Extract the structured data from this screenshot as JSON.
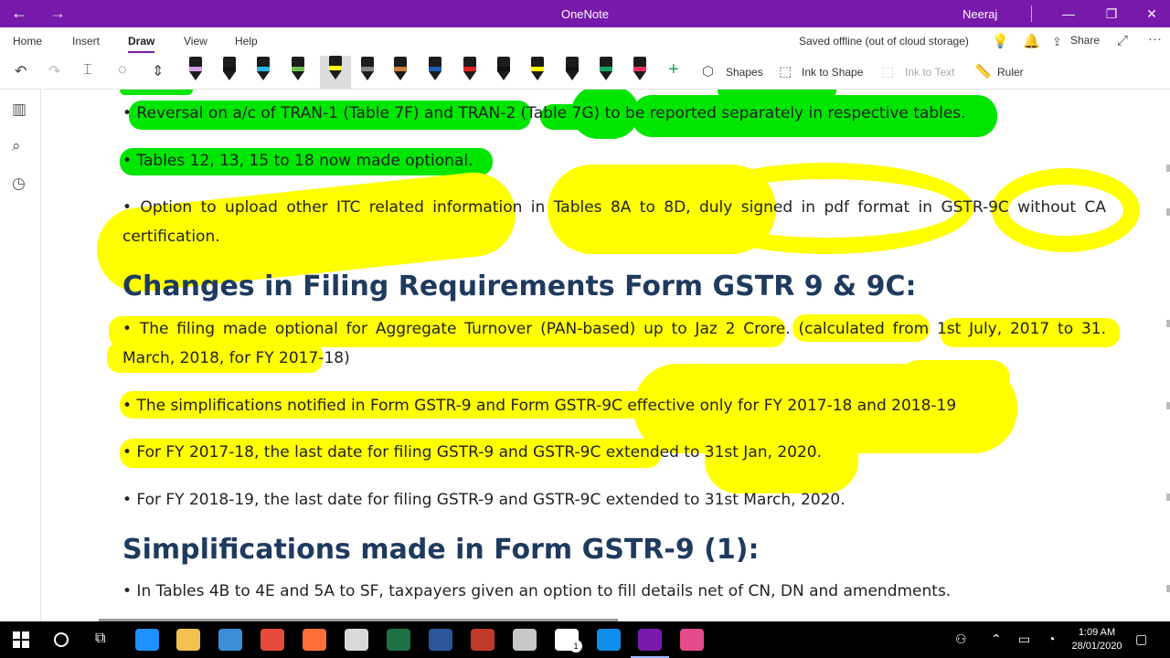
{
  "titlebar": {
    "back": "←",
    "forward": "→",
    "title": "OneNote",
    "user": "Neeraj",
    "minimize": "—",
    "restore": "❐",
    "close": "✕"
  },
  "menu": {
    "tabs": [
      "Home",
      "Insert",
      "Draw",
      "View",
      "Help"
    ],
    "active_tab": "Draw",
    "status": "Saved offline (out of cloud storage)",
    "share": "Share",
    "more": "···"
  },
  "toolbar": {
    "shapes": "Shapes",
    "ink_to_shape": "Ink to Shape",
    "ink_to_text": "Ink to Text",
    "ruler": "Ruler",
    "add": "+",
    "pens": [
      {
        "color": "#d7a0e8"
      },
      {
        "color": "#111111"
      },
      {
        "color": "#2ab7e8"
      },
      {
        "color": "#6cc24a"
      },
      {
        "color": "#ffff00",
        "selected": true
      },
      {
        "color": "#888888"
      },
      {
        "color": "#c77d3b"
      },
      {
        "color": "#1e5fb0"
      },
      {
        "color": "#e02020"
      },
      {
        "color": "#111111"
      },
      {
        "color": "#ffff00"
      },
      {
        "color": "#111111"
      },
      {
        "color": "#1aa260"
      },
      {
        "color": "#e8305a"
      }
    ]
  },
  "content": {
    "bullets_top": [
      "• Reversal on a/c of TRAN-1 (Table 7F) and TRAN-2 (Table 7G) to be reported separately in respective tables.",
      "• Tables 12, 13, 15 to 18 now made optional.",
      "• Option to upload other ITC related information in Tables 8A to 8D, duly signed in pdf format in GSTR-9C without CA",
      "certification."
    ],
    "heading1": "Changes in Filing Requirements Form GSTR 9 & 9C:",
    "bullets_mid": [
      "• The filing made optional for Aggregate Turnover (PAN-based) up to Jaz 2 Crore. (calculated from 1st July, 2017 to 31.",
      "March, 2018, for FY 2017-18)",
      "• The simplifications notified in Form GSTR-9 and Form GSTR-9C effective only for FY 2017-18 and 2018-19",
      "• For FY 2017-18, the last date for filing GSTR-9 and GSTR-9C extended to 31st Jan, 2020.",
      "• For FY 2018-19, the last date for filing GSTR-9 and GSTR-9C extended to 31st March, 2020."
    ],
    "heading2": "Simplifications made in Form GSTR-9 (1):",
    "bullets_bottom": [
      "• In Tables 4B to 4E and 5A to SF, taxpayers given an option to fill details net of CN, DN and amendments."
    ]
  },
  "taskbar": {
    "clock_time": "1:09 AM",
    "clock_date": "28/01/2020",
    "mail_badge": "1",
    "apps": [
      {
        "name": "edge",
        "color": "#1e90ff"
      },
      {
        "name": "file-explorer",
        "color": "#f2c14e"
      },
      {
        "name": "photos",
        "color": "#3a8fd6"
      },
      {
        "name": "chrome",
        "color": "#e64a3b"
      },
      {
        "name": "firefox",
        "color": "#ff7139"
      },
      {
        "name": "notebook",
        "color": "#d9d9d9"
      },
      {
        "name": "excel",
        "color": "#1d7044"
      },
      {
        "name": "word",
        "color": "#2b579a"
      },
      {
        "name": "app-red",
        "color": "#c0392b"
      },
      {
        "name": "app-parrot",
        "color": "#c8c8c8"
      },
      {
        "name": "mail",
        "color": "#ffffff"
      },
      {
        "name": "teamviewer",
        "color": "#0e8ee9"
      },
      {
        "name": "onenote",
        "color": "#7719AA"
      },
      {
        "name": "camera",
        "color": "#e44b8d"
      }
    ]
  }
}
